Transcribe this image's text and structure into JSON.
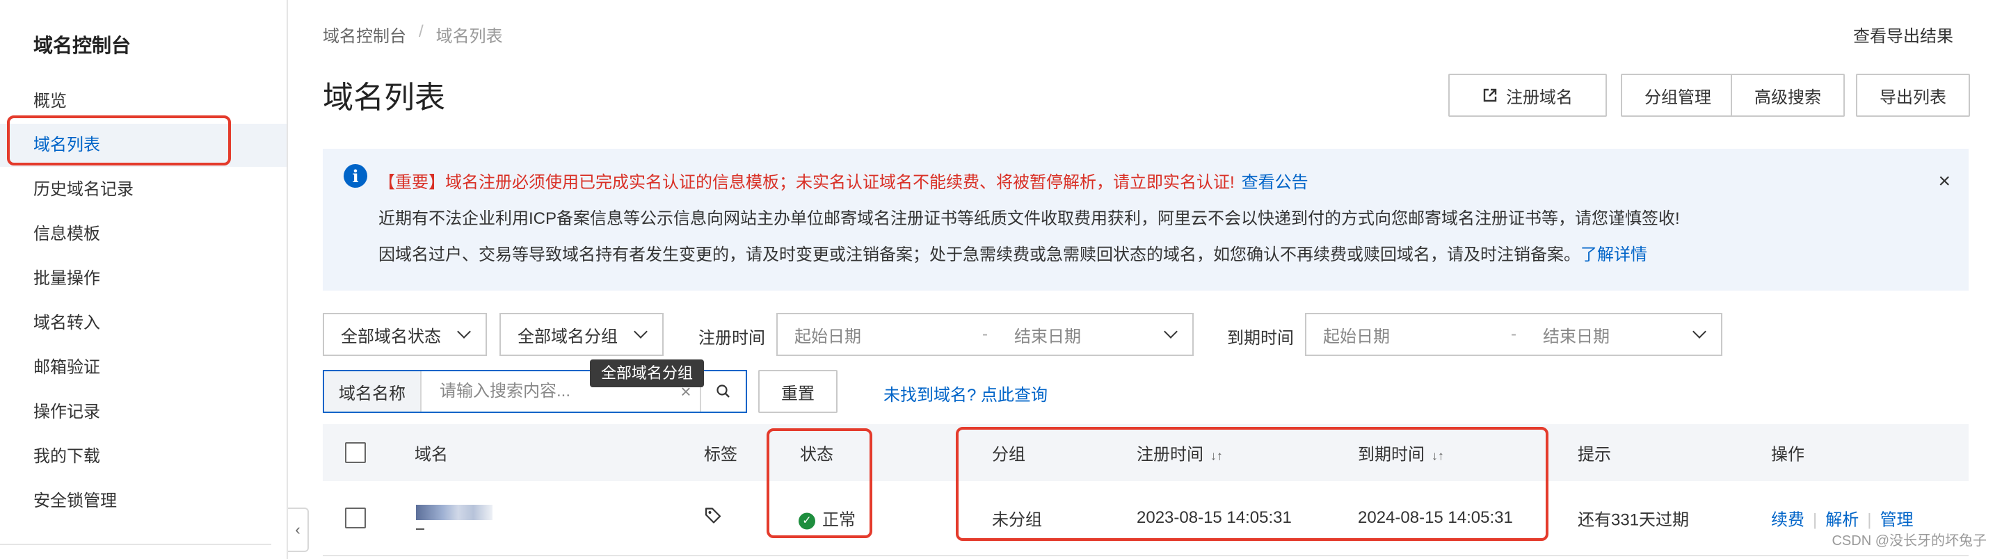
{
  "sidebar": {
    "title": "域名控制台",
    "items": [
      {
        "label": "概览"
      },
      {
        "label": "域名列表"
      },
      {
        "label": "历史域名记录"
      },
      {
        "label": "信息模板"
      },
      {
        "label": "批量操作"
      },
      {
        "label": "域名转入"
      },
      {
        "label": "邮箱验证"
      },
      {
        "label": "操作记录"
      },
      {
        "label": "我的下载"
      },
      {
        "label": "安全锁管理"
      }
    ],
    "active_index": 1
  },
  "breadcrumb": {
    "root": "域名控制台",
    "separator": "/",
    "current": "域名列表"
  },
  "header": {
    "title": "域名列表",
    "export_result": "查看导出结果",
    "buttons": {
      "register": "注册域名",
      "groups": "分组管理",
      "advanced": "高级搜索",
      "export": "导出列表"
    }
  },
  "notice": {
    "line1": "【重要】域名注册必须使用已完成实名认证的信息模板；未实名认证域名不能续费、将被暂停解析，请立即实名认证!",
    "line1_link": "查看公告",
    "line2": "近期有不法企业利用ICP备案信息等公示信息向网站主办单位邮寄域名注册证书等纸质文件收取费用获利，阿里云不会以快递到付的方式向您邮寄域名注册证书等，请您谨慎签收!",
    "line3": "因域名过户、交易等导致域名持有者发生变更的，请及时变更或注销备案；处于急需续费或急需赎回状态的域名，如您确认不再续费或赎回域名，请及时注销备案。",
    "line3_link": "了解详情"
  },
  "filters": {
    "status_select": "全部域名状态",
    "group_select": "全部域名分组",
    "group_tooltip": "全部域名分组",
    "register_time_label": "注册时间",
    "expire_time_label": "到期时间",
    "start_date": "起始日期",
    "end_date": "结束日期",
    "range_sep": "-",
    "search_label": "域名名称",
    "search_placeholder": "请输入搜索内容...",
    "reset": "重置",
    "not_found_link": "未找到域名? 点此查询"
  },
  "table": {
    "headers": {
      "domain": "域名",
      "tag": "标签",
      "status": "状态",
      "group": "分组",
      "register_time": "注册时间",
      "expire_time": "到期时间",
      "hint": "提示",
      "ops": "操作"
    },
    "rows": [
      {
        "status": "正常",
        "group": "未分组",
        "register_time": "2023-08-15 14:05:31",
        "expire_time": "2024-08-15 14:05:31",
        "hint": "还有331天过期",
        "ops": {
          "renew": "续费",
          "resolve": "解析",
          "manage": "管理"
        }
      }
    ]
  },
  "watermark": "CSDN @没长牙的坏兔子",
  "colors": {
    "accent": "#0064c8",
    "warning": "#d93026",
    "annotation": "#e43b2c",
    "success": "#1e8e3e"
  }
}
